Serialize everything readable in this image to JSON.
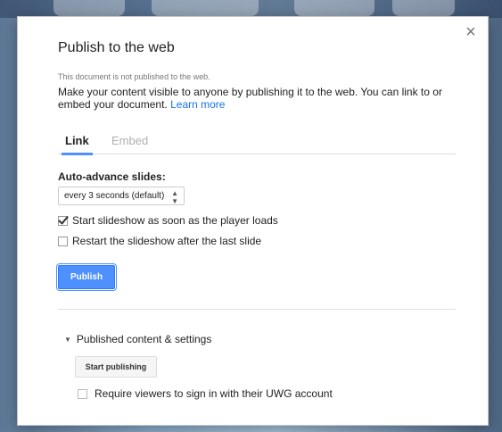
{
  "dialog": {
    "title": "Publish to the web",
    "close_glyph": "×",
    "not_published_note": "This document is not published to the web.",
    "description": "Make your content visible to anyone by publishing it to the web. You can link to or embed your document.",
    "learn_more": "Learn more"
  },
  "tabs": [
    {
      "label": "Link",
      "active": true
    },
    {
      "label": "Embed",
      "active": false
    }
  ],
  "link_tab": {
    "auto_advance_label": "Auto-advance slides:",
    "auto_advance_value": "every 3 seconds (default)",
    "options": [
      {
        "label": "Start slideshow as soon as the player loads",
        "checked": true
      },
      {
        "label": "Restart the slideshow after the last slide",
        "checked": false
      }
    ],
    "publish_button": "Publish"
  },
  "published_settings": {
    "toggle_label": "Published content & settings",
    "start_publishing_button": "Start publishing",
    "require_signin_label": "Require viewers to sign in with their UWG account",
    "require_signin_checked": false
  },
  "colors": {
    "accent": "#4d90fe",
    "link": "#1a73e8"
  }
}
